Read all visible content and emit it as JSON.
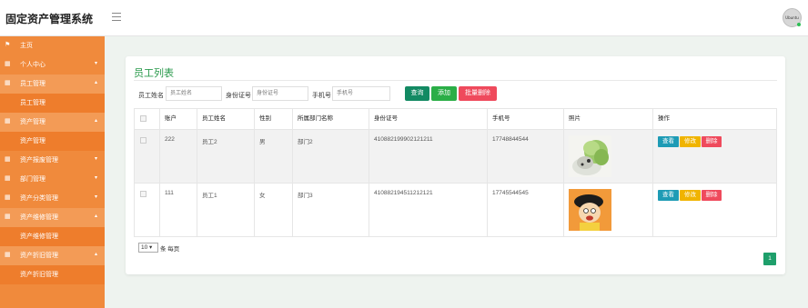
{
  "app": {
    "title": "固定资产管理系统",
    "avatar_text": "Ubuntu"
  },
  "sidebar": {
    "items": [
      {
        "label": "主页",
        "icon": "flag-icon",
        "expandable": false
      },
      {
        "label": "个人中心",
        "icon": "grid-icon",
        "expandable": true
      },
      {
        "label": "员工管理",
        "icon": "grid-icon",
        "expandable": true
      },
      {
        "label": "员工管理",
        "icon": "",
        "expandable": false
      },
      {
        "label": "资产管理",
        "icon": "grid-icon",
        "expandable": true
      },
      {
        "label": "资产管理",
        "icon": "",
        "expandable": false
      },
      {
        "label": "资产报废管理",
        "icon": "grid-icon",
        "expandable": true
      },
      {
        "label": "部门管理",
        "icon": "grid-icon",
        "expandable": true
      },
      {
        "label": "资产分类管理",
        "icon": "grid-icon",
        "expandable": true
      },
      {
        "label": "资产维修管理",
        "icon": "grid-icon",
        "expandable": true
      },
      {
        "label": "资产维修管理",
        "icon": "",
        "expandable": false
      },
      {
        "label": "资产折旧管理",
        "icon": "grid-icon",
        "expandable": true
      },
      {
        "label": "资产折旧管理",
        "icon": "",
        "expandable": false
      }
    ]
  },
  "main": {
    "title": "员工列表",
    "filters": {
      "name_label": "员工姓名",
      "name_placeholder": "员工姓名",
      "idcard_label": "身份证号",
      "idcard_placeholder": "身份证号",
      "phone_label": "手机号",
      "phone_placeholder": "手机号"
    },
    "buttons": {
      "search": "查询",
      "add": "添加",
      "batch_delete": "批量删除"
    },
    "table": {
      "headers": [
        "",
        "账户",
        "员工姓名",
        "性别",
        "所属部门名称",
        "身份证号",
        "手机号",
        "照片",
        "操作"
      ],
      "rows": [
        {
          "account": "222",
          "name": "员工2",
          "gender": "男",
          "dept": "部门2",
          "idcard": "410882199902121211",
          "phone": "17748844544",
          "photo": "cabbage-dog-photo"
        },
        {
          "account": "111",
          "name": "员工1",
          "gender": "女",
          "dept": "部门3",
          "idcard": "410882194511212121",
          "phone": "17745544545",
          "photo": "cartoon-boy-photo"
        }
      ],
      "actions": {
        "view": "查看",
        "edit": "修改",
        "delete": "删除"
      }
    },
    "pagination": {
      "page_size": "10",
      "page_size_suffix": "条 每页",
      "current_page": "1"
    }
  },
  "colors": {
    "sidebar": "#f08a3c",
    "accent_green": "#2a9a4c",
    "view": "#1e9bb5",
    "edit": "#f0b400",
    "delete": "#ef4a5c",
    "search": "#138a63",
    "add": "#2bae47",
    "batch_delete": "#ef4a5c"
  }
}
